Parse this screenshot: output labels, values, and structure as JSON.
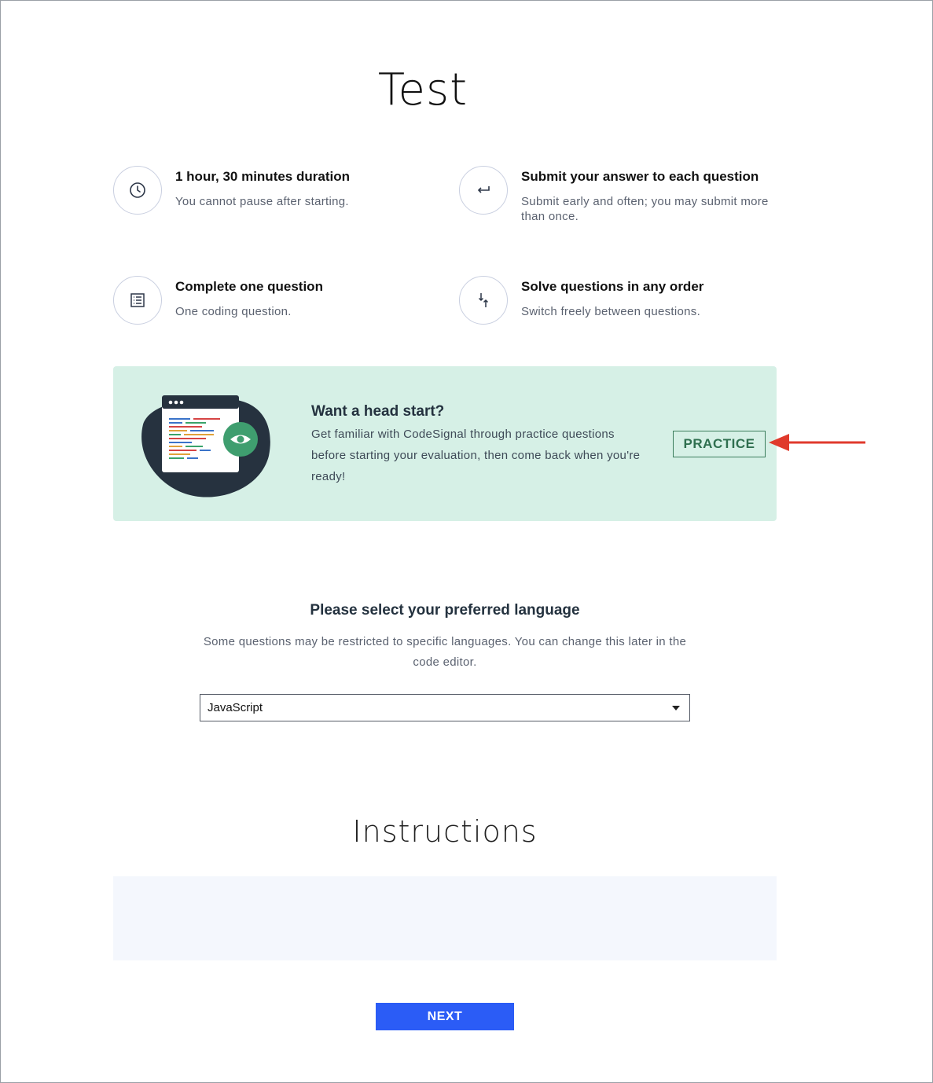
{
  "page": {
    "title": "Test"
  },
  "features": [
    {
      "icon": "clock-icon",
      "title": "1 hour, 30 minutes duration",
      "desc": "You cannot pause after starting."
    },
    {
      "icon": "return-arrow-icon",
      "title": "Submit your answer to each question",
      "desc": "Submit early and often; you may submit more than once."
    },
    {
      "icon": "list-icon",
      "title": "Complete one question",
      "desc": "One coding question."
    },
    {
      "icon": "swap-arrows-icon",
      "title": "Solve questions in any order",
      "desc": "Switch freely between questions."
    }
  ],
  "banner": {
    "title": "Want a head start?",
    "desc": "Get familiar with CodeSignal through practice questions before starting your evaluation, then come back when you're ready!",
    "practice_label": "PRACTICE",
    "bg_color": "#d6f0e6"
  },
  "language": {
    "title": "Please select your preferred language",
    "desc": "Some questions may be restricted to specific languages. You can change this later in the code editor.",
    "selected": "JavaScript"
  },
  "instructions": {
    "title": "Instructions"
  },
  "next_label": "NEXT",
  "colors": {
    "accent": "#2b5cf6",
    "annotation_arrow": "#e03a2c",
    "practice_green": "#3b7d5c"
  }
}
